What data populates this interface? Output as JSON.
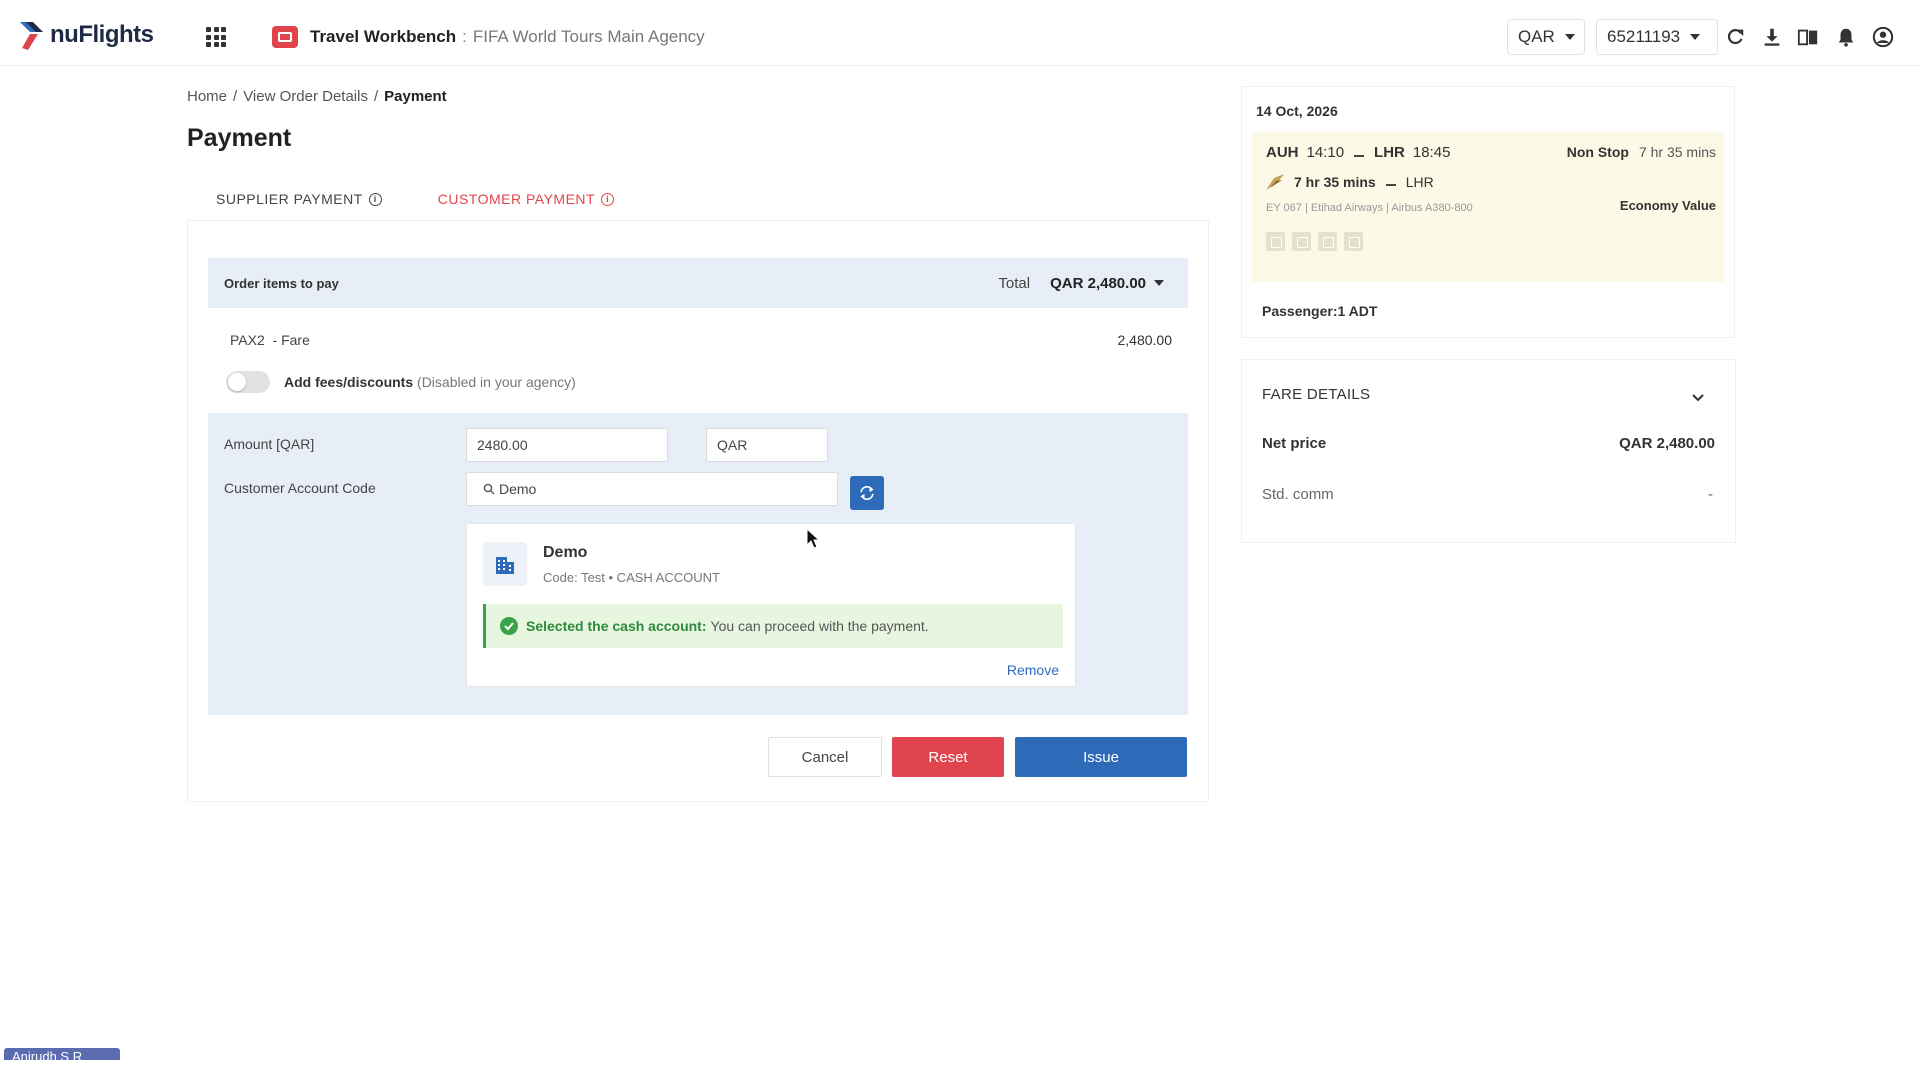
{
  "header": {
    "brand": "nuFlights",
    "app_title": "Travel Workbench",
    "separator": ":",
    "agency": "FIFA World Tours Main Agency",
    "currency": "QAR",
    "account_id": "65211193",
    "accent_color": "#e0454e",
    "icons": [
      "apps-grid-icon",
      "refresh-icon",
      "download-icon",
      "book-icon",
      "bell-icon",
      "user-icon"
    ]
  },
  "breadcrumb": {
    "items": [
      "Home",
      "View Order Details"
    ],
    "separator": "/",
    "current": "Payment"
  },
  "page": {
    "title": "Payment"
  },
  "tabs": [
    {
      "label": "SUPPLIER PAYMENT",
      "active": false
    },
    {
      "label": "CUSTOMER PAYMENT",
      "active": true
    }
  ],
  "order": {
    "heading": "Order items to pay",
    "total_label": "Total",
    "total_value": "QAR 2,480.00",
    "item_label": "PAX2  - Fare",
    "item_amount": "2,480.00",
    "fees_label": "Add fees/discounts",
    "fees_note": "(Disabled in your agency)",
    "fees_enabled": false
  },
  "payment": {
    "amount_label": "Amount [QAR]",
    "amount_value": "2480.00",
    "currency_value": "QAR",
    "account_label": "Customer Account Code",
    "account_search_value": "Demo"
  },
  "account": {
    "name": "Demo",
    "code": "Code: Test • CASH ACCOUNT",
    "success_bold": "Selected the cash account:",
    "success_text": "You can proceed with the payment.",
    "remove_label": "Remove"
  },
  "actions": {
    "cancel": "Cancel",
    "reset": "Reset",
    "issue": "Issue"
  },
  "flight": {
    "date": "14 Oct, 2026",
    "origin": "AUH",
    "dep_time": "14:10",
    "destination": "LHR",
    "arr_time": "18:45",
    "stops": "Non Stop",
    "duration": "7 hr 35 mins",
    "leg_duration": "7 hr 35 mins",
    "leg_destination": "LHR",
    "details": "EY 067 | Etihad Airways | Airbus A380-800",
    "cabin": "Economy Value",
    "passengers": "Passenger:1 ADT"
  },
  "fare_details": {
    "heading": "FARE DETAILS",
    "net_label": "Net price",
    "net_value": "QAR 2,480.00",
    "comm_label": "Std. comm",
    "comm_value": "-"
  },
  "user_chip": "Anirudh S R"
}
